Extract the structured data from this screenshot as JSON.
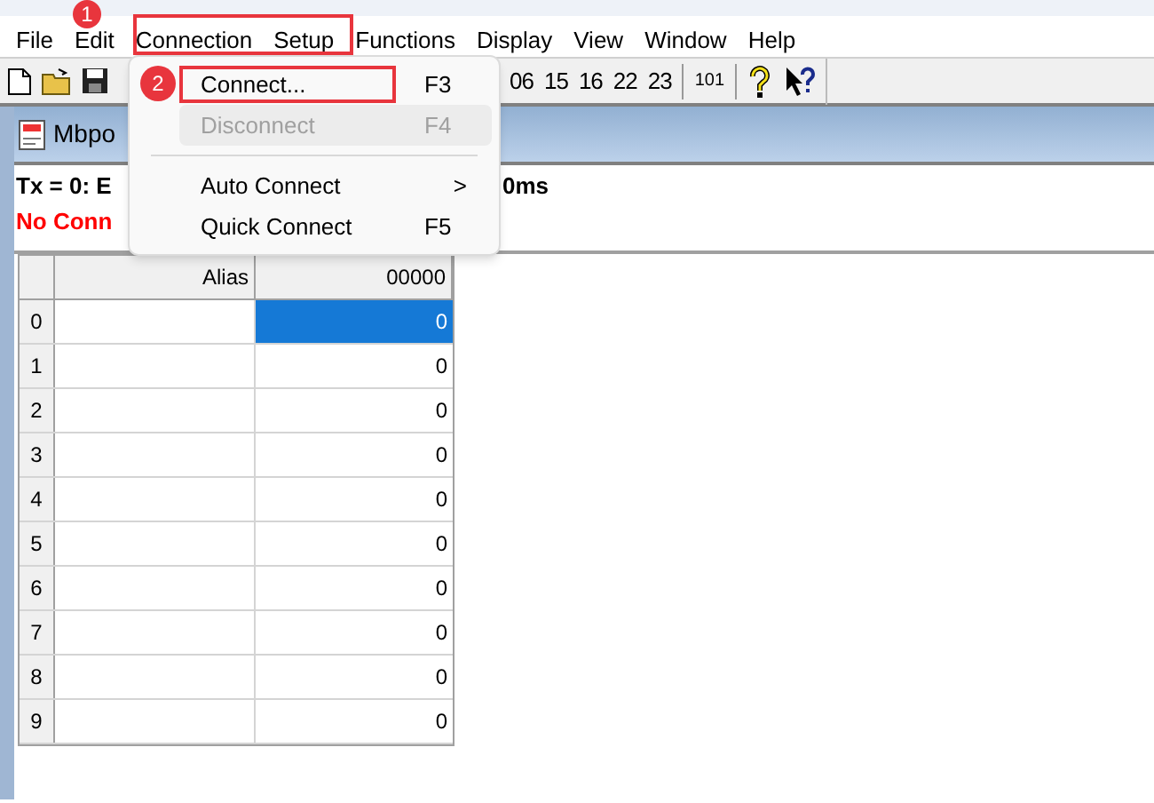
{
  "menu_bar": [
    {
      "label": "File"
    },
    {
      "label": "Edit"
    },
    {
      "label": "Connection"
    },
    {
      "label": "Setup"
    },
    {
      "label": "Functions"
    },
    {
      "label": "Display"
    },
    {
      "label": "View"
    },
    {
      "label": "Window"
    },
    {
      "label": "Help"
    }
  ],
  "toolbar": {
    "function_codes": [
      "06",
      "15",
      "16",
      "22",
      "23"
    ],
    "code_101": "101"
  },
  "child_window": {
    "title": "Mbpo",
    "tx_line": "Tx = 0: E",
    "tx_line_end": "0ms",
    "status": "No Conn"
  },
  "grid": {
    "columns": [
      "Alias",
      "00000"
    ],
    "rows": [
      {
        "header": "0",
        "value": "0",
        "selected": true
      },
      {
        "header": "1",
        "value": "0",
        "selected": false
      },
      {
        "header": "2",
        "value": "0",
        "selected": false
      },
      {
        "header": "3",
        "value": "0",
        "selected": false
      },
      {
        "header": "4",
        "value": "0",
        "selected": false
      },
      {
        "header": "5",
        "value": "0",
        "selected": false
      },
      {
        "header": "6",
        "value": "0",
        "selected": false
      },
      {
        "header": "7",
        "value": "0",
        "selected": false
      },
      {
        "header": "8",
        "value": "0",
        "selected": false
      },
      {
        "header": "9",
        "value": "0",
        "selected": false
      }
    ]
  },
  "connection_menu": [
    {
      "kind": "item",
      "label": "Connect...",
      "shortcut": "F3",
      "disabled": false,
      "framed": true
    },
    {
      "kind": "item",
      "label": "Disconnect",
      "shortcut": "F4",
      "disabled": true
    },
    {
      "kind": "separator"
    },
    {
      "kind": "submenu",
      "label": "Auto Connect",
      "arrow": ">",
      "disabled": false
    },
    {
      "kind": "item",
      "label": "Quick Connect",
      "shortcut": "F5",
      "disabled": false
    }
  ],
  "step_badges": [
    "1",
    "2"
  ]
}
